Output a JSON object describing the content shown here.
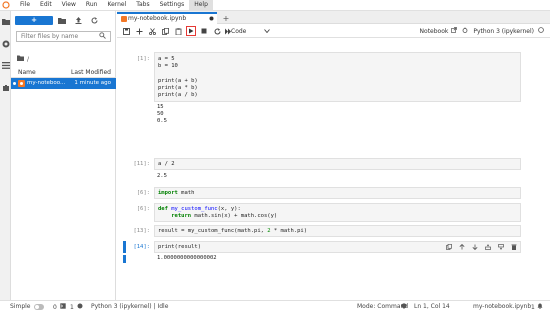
{
  "menu": [
    "File",
    "Edit",
    "View",
    "Run",
    "Kernel",
    "Tabs",
    "Settings",
    "Help"
  ],
  "menu_active": "Help",
  "filebrowser": {
    "new_label": "+",
    "filter_placeholder": "Filter files by name",
    "crumb": "/",
    "col_name": "Name",
    "col_modified": "Last Modified",
    "rows": [
      {
        "name": "my-notebook.ipynb",
        "display": "my-noteboo...",
        "modified": "1 minute ago"
      }
    ]
  },
  "tab": {
    "title": "my-notebook.ipynb",
    "add": "+"
  },
  "toolbar": {
    "cell_type": "Code",
    "notebook_label": "Notebook",
    "kernel_label": "Python 3 (ipykernel)"
  },
  "cells": [
    {
      "prompt": "[1]:",
      "source": "a = 5\nb = 10\n\nprint(a + b)\nprint(a * b)\nprint(a / b)",
      "output": "15\n50\n0.5"
    },
    {
      "prompt": "[11]:",
      "source": "a / 2",
      "output": "2.5"
    },
    {
      "prompt": "[6]:",
      "source": "import math",
      "output": ""
    },
    {
      "prompt": "[6]:",
      "source": "def my_custom_func(x, y):\n    return math.sin(x) + math.cos(y)",
      "output": ""
    },
    {
      "prompt": "[13]:",
      "source": "result = my_custom_func(math.pi, 2 * math.pi)",
      "output": ""
    },
    {
      "prompt": "[14]:",
      "source": "print(result)",
      "output": "1.0000000000000002"
    }
  ],
  "status": {
    "mode_label": "Simple",
    "count_a": "0",
    "count_b": "1",
    "kernel": "Python 3 (ipykernel) | Idle",
    "mode": "Mode: Command",
    "position": "Ln 1, Col 14",
    "file": "my-notebook.ipynb",
    "count_c": "1"
  },
  "colors": {
    "accent": "#1976d2",
    "run_highlight": "#e53935"
  }
}
